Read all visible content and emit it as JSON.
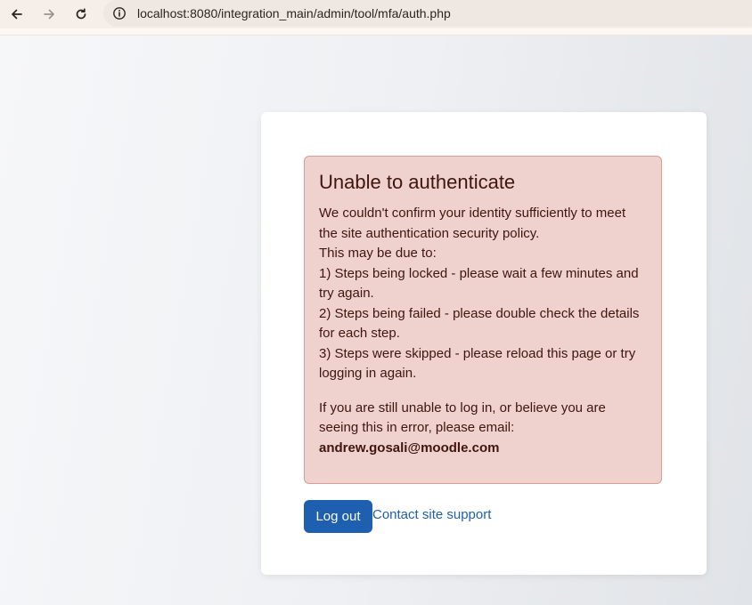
{
  "browser": {
    "url": "localhost:8080/integration_main/admin/tool/mfa/auth.php",
    "back_icon": "arrow-left",
    "forward_icon": "arrow-right",
    "reload_icon": "reload",
    "info_icon": "info-circle"
  },
  "alert": {
    "title": "Unable to authenticate",
    "lines": [
      "We couldn't confirm your identity sufficiently to meet the site authentication security policy.",
      "This may be due to:",
      "1) Steps being locked - please wait a few minutes and try again.",
      "2) Steps being failed - please double check the details for each step.",
      "3) Steps were skipped - please reload this page or try logging in again."
    ],
    "footer_text": "If you are still unable to log in, or believe you are seeing this in error, please email:",
    "email": "andrew.gosali@moodle.com",
    "colors": {
      "background": "#efd2cd",
      "border": "#d89e95",
      "text": "#3f1510"
    }
  },
  "actions": {
    "logout_label": "Log out",
    "support_label": "Contact site support",
    "colors": {
      "primary": "#1f5fb0"
    }
  }
}
